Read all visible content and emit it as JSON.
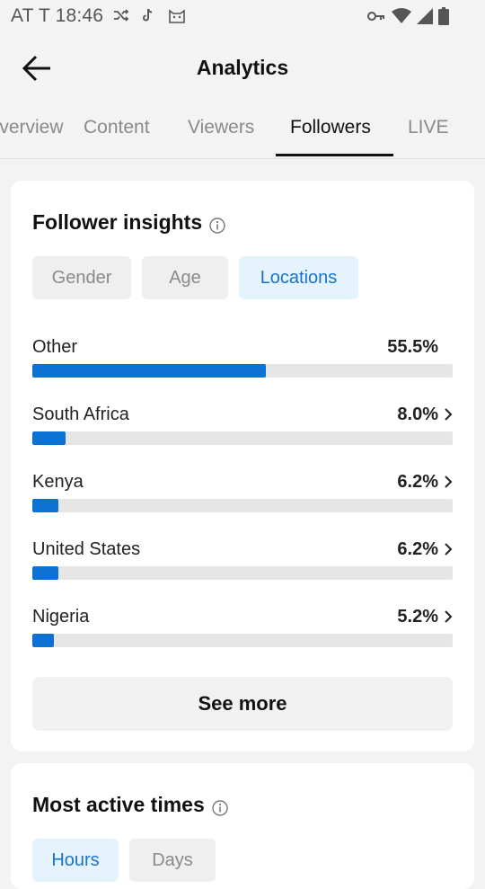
{
  "status_bar": {
    "carrier_time": "AT T  18:46",
    "icons_left": [
      "shuffle-icon",
      "tiktok-icon",
      "cat-icon"
    ],
    "icons_right": [
      "key-icon",
      "wifi-icon",
      "signal-icon",
      "battery-icon"
    ]
  },
  "header": {
    "title": "Analytics",
    "back_icon": "back-arrow-icon"
  },
  "tabs": [
    {
      "label": "Overview",
      "active": false
    },
    {
      "label": "Content",
      "active": false
    },
    {
      "label": "Viewers",
      "active": false
    },
    {
      "label": "Followers",
      "active": true
    },
    {
      "label": "LIVE",
      "active": false
    }
  ],
  "follower_insights": {
    "title": "Follower insights",
    "chips": [
      {
        "label": "Gender",
        "active": false
      },
      {
        "label": "Age",
        "active": false
      },
      {
        "label": "Locations",
        "active": true
      }
    ],
    "locations": [
      {
        "name": "Other",
        "percent_label": "55.5%",
        "value": 55.5,
        "has_chevron": false
      },
      {
        "name": "South Africa",
        "percent_label": "8.0%",
        "value": 8.0,
        "has_chevron": true
      },
      {
        "name": "Kenya",
        "percent_label": "6.2%",
        "value": 6.2,
        "has_chevron": true
      },
      {
        "name": "United States",
        "percent_label": "6.2%",
        "value": 6.2,
        "has_chevron": true
      },
      {
        "name": "Nigeria",
        "percent_label": "5.2%",
        "value": 5.2,
        "has_chevron": true
      }
    ],
    "see_more": "See more"
  },
  "most_active_times": {
    "title": "Most active times",
    "chips": [
      {
        "label": "Hours",
        "active": true
      },
      {
        "label": "Days",
        "active": false
      }
    ]
  },
  "colors": {
    "accent": "#0b72d3",
    "chip_active_bg": "#e5f3fd",
    "chip_active_text": "#1a72c9",
    "background": "#f3f3f3"
  }
}
